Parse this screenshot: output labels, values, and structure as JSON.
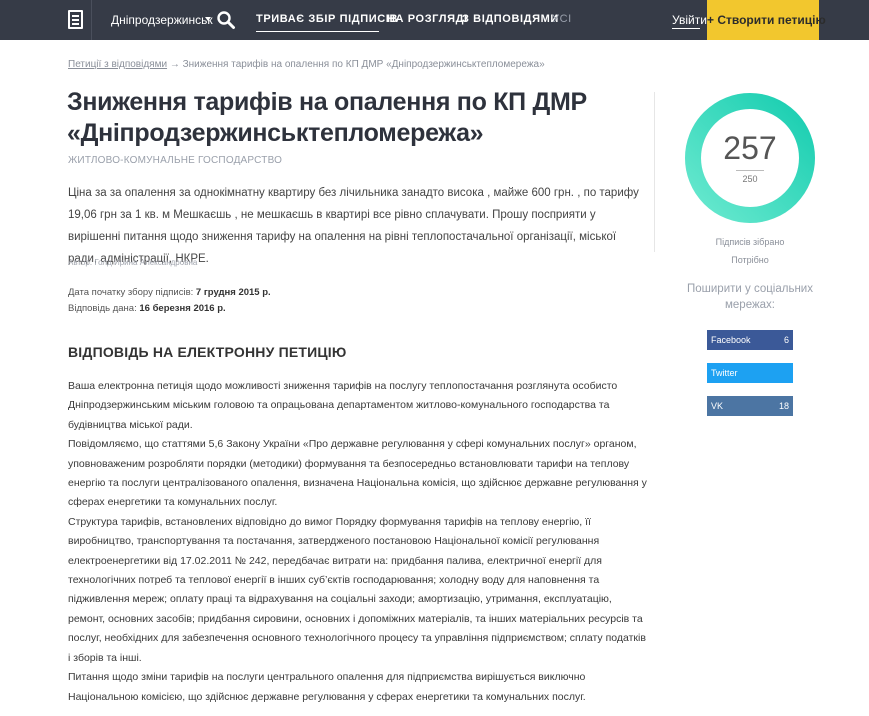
{
  "header": {
    "city": "Дніпродзержинськ",
    "nav": [
      "Триває збір підписів",
      "На розгляді",
      "З відповідями",
      "Усі"
    ],
    "login": "Увійти",
    "create": "+ Створити петицію"
  },
  "breadcrumb": {
    "link": "Петиції з відповідями",
    "sep": " → ",
    "current": "Зниження тарифів на опалення по КП ДМР «Дніпродзержинськтепломережа»"
  },
  "petition": {
    "title": "Зниження тарифів на опалення по КП ДМР «Дніпродзержинськтепломережа»",
    "category": "Житлово-комунальне господарство",
    "description": "Ціна за за опалення за однокімнатну квартиру без лічильника занадто висока , майже 600 грн. , по тарифу 19,06 грн за 1 кв. м Мешкаєшь , не мешкаєшь в квартирі все рівно сплачувати. Прошу посприяти у вирішенні питання щодо зниження тарифу на опалення на рівні теплопостачальної організації, міської ради, адміністрації, НКРЕ.",
    "author_label": "Автор:",
    "author": "Голд Ирина Александровна",
    "start_label": "Дата початку збору підписів:",
    "start_date": "7 грудня 2015 р.",
    "answer_label": "Відповідь дана:",
    "answer_date": "16 березня 2016 р."
  },
  "answer": {
    "heading": "Відповідь на електронну петицію",
    "paragraphs": [
      "Ваша електронна петиція щодо можливості зниження тарифів на послугу теплопостачання розглянута особисто Дніпродзержинським міським головою та опрацьована департаментом житлово-комунального господарства та будівництва міської ради.",
      "Повідомляємо, що статтями 5,6 Закону України «Про державне регулювання у сфері комунальних послуг» органом, уповноваженим розробляти порядки (методики) формування та безпосередньо встановлювати тарифи на теплову енергію та послуги централізованого опалення, визначена Національна комісія, що здійснює державне регулювання у сферах енергетики та комунальних послуг.",
      "Структура тарифів, встановлених відповідно до вимог Порядку формування тарифів на теплову енергію, її виробництво, транспортування та постачання, затвердженого постановою Національної комісії регулювання електроенергетики від 17.02.2011 № 242, передбачає витрати на: придбання палива, електричної енергії для технологічних потреб та теплової енергії в інших суб’єктів господарювання; холодну воду для наповнення та підживлення мереж; оплату праці та відрахування на соціальні заходи; амортизацію, утримання, експлуатацію, ремонт, основних засобів; придбання сировини, основних і допоміжних матеріалів, та інших матеріальних ресурсів та послуг, необхідних для забезпечення основного технологічного процесу та управління підприємством; сплату податків і зборів та інші.",
      "Питання щодо зміни тарифів на послуги центрального опалення для підприємства вирішується виключно Національною комісією, що здійснює державне регулювання у сферах енергетики та комунальних послуг."
    ]
  },
  "sidebar": {
    "count": "257",
    "target": "250",
    "collected": "Підписів зібрано",
    "needed": "Потрібно",
    "progress": 1.0,
    "share": "Поширити у соціальних мережах:",
    "social": [
      {
        "name": "Facebook",
        "count": "6",
        "color": "#3b5998"
      },
      {
        "name": "Twitter",
        "count": "",
        "color": "#1da1f2"
      },
      {
        "name": "VK",
        "count": "18",
        "color": "#4c75a3"
      }
    ]
  },
  "colors": {
    "header_bg": "#363b47",
    "accent_yellow": "#f2c72e",
    "progress_start": "#1fd1b4",
    "progress_end": "#5ee6c9"
  }
}
